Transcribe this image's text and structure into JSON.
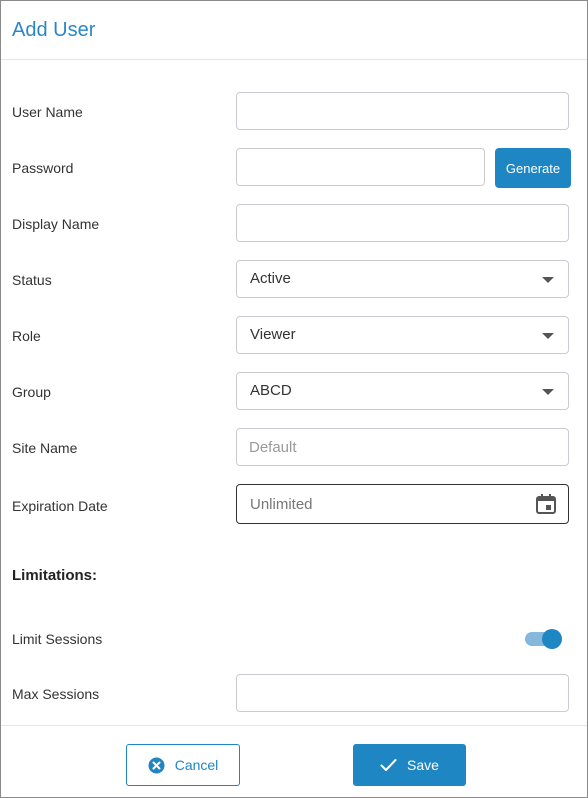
{
  "dialog": {
    "title": "Add User",
    "generate_label": "Generate",
    "fields": {
      "user_name": {
        "label": "User Name",
        "value": ""
      },
      "password": {
        "label": "Password",
        "value": ""
      },
      "display_name": {
        "label": "Display Name",
        "value": ""
      },
      "status": {
        "label": "Status",
        "value": "Active"
      },
      "role": {
        "label": "Role",
        "value": "Viewer"
      },
      "group": {
        "label": "Group",
        "value": "ABCD"
      },
      "site_name": {
        "label": "Site Name",
        "placeholder": "Default",
        "value": ""
      },
      "expiration_date": {
        "label": "Expiration Date",
        "value": "Unlimited"
      }
    },
    "limitations": {
      "heading": "Limitations:",
      "limit_sessions": {
        "label": "Limit Sessions",
        "enabled": true
      },
      "max_sessions": {
        "label": "Max Sessions",
        "value": ""
      }
    },
    "footer": {
      "cancel_label": "Cancel",
      "save_label": "Save"
    },
    "icons": {
      "cancel": "close-circle-icon",
      "save": "check-icon",
      "calendar": "calendar-icon"
    },
    "colors": {
      "accent": "#1f86c4",
      "title": "#2a86c7"
    }
  }
}
